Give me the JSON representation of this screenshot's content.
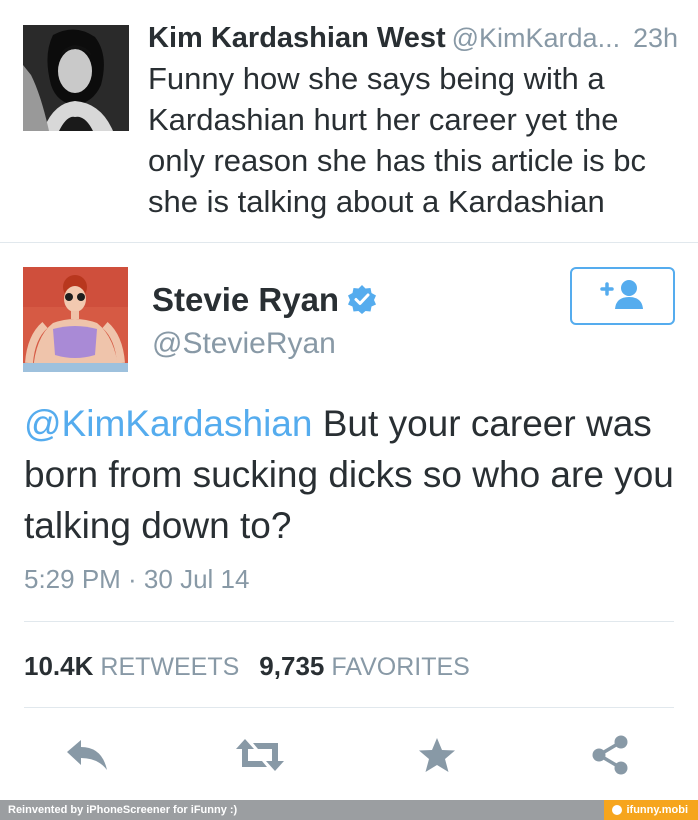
{
  "reply_tweet": {
    "name": "Kim Kardashian West",
    "handle": "@KimKarda...",
    "time": "23h",
    "text": "Funny how she says being with a Kardashian hurt her career yet the only reason she has this article is bc she is talking about a Kardashian"
  },
  "main_tweet": {
    "name": "Stevie Ryan",
    "handle": "@StevieRyan",
    "mention": "@KimKardashian",
    "text": " But your career was born from sucking dicks so who are you talking down to?",
    "timestamp": "5:29 PM · 30 Jul 14",
    "retweets_count": "10.4K",
    "retweets_label": "RETWEETS",
    "favorites_count": "9,735",
    "favorites_label": "FAVORITES"
  },
  "actions": {
    "reply": "reply-icon",
    "retweet": "retweet-icon",
    "favorite": "star-icon",
    "share": "share-icon"
  },
  "footer": {
    "left_text": "Reinvented by iPhoneScreener for iFunny :)",
    "right_text": "ifunny.mobi"
  },
  "colors": {
    "accent": "#55acee",
    "muted": "#8899a6",
    "icon": "#8899a6"
  }
}
